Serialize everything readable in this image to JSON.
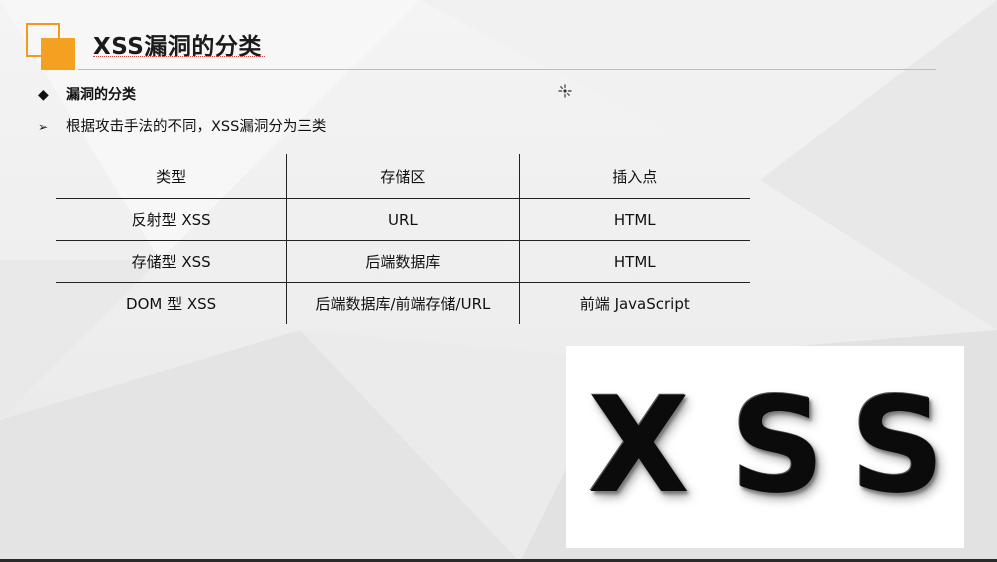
{
  "slide": {
    "title": "XSS漏洞的分类",
    "bullets": [
      {
        "marker": "◆",
        "text": "漏洞的分类"
      },
      {
        "marker": "➢",
        "text": "根据攻击手法的不同，XSS漏洞分为三类"
      }
    ]
  },
  "table": {
    "headers": [
      "类型",
      "存储区",
      "插入点"
    ],
    "rows": [
      [
        "反射型 XSS",
        "URL",
        "HTML"
      ],
      [
        "存储型 XSS",
        "后端数据库",
        "HTML"
      ],
      [
        "DOM 型 XSS",
        "后端数据库/前端存储/URL",
        "前端 JavaScript"
      ]
    ]
  },
  "image": {
    "letters": [
      "X",
      "S",
      "S"
    ]
  },
  "colors": {
    "accent": "#f4a020",
    "rule": "#222222"
  },
  "icons": {
    "cursor": "busy-cursor-icon",
    "logo": "orange-squares-logo-icon"
  }
}
